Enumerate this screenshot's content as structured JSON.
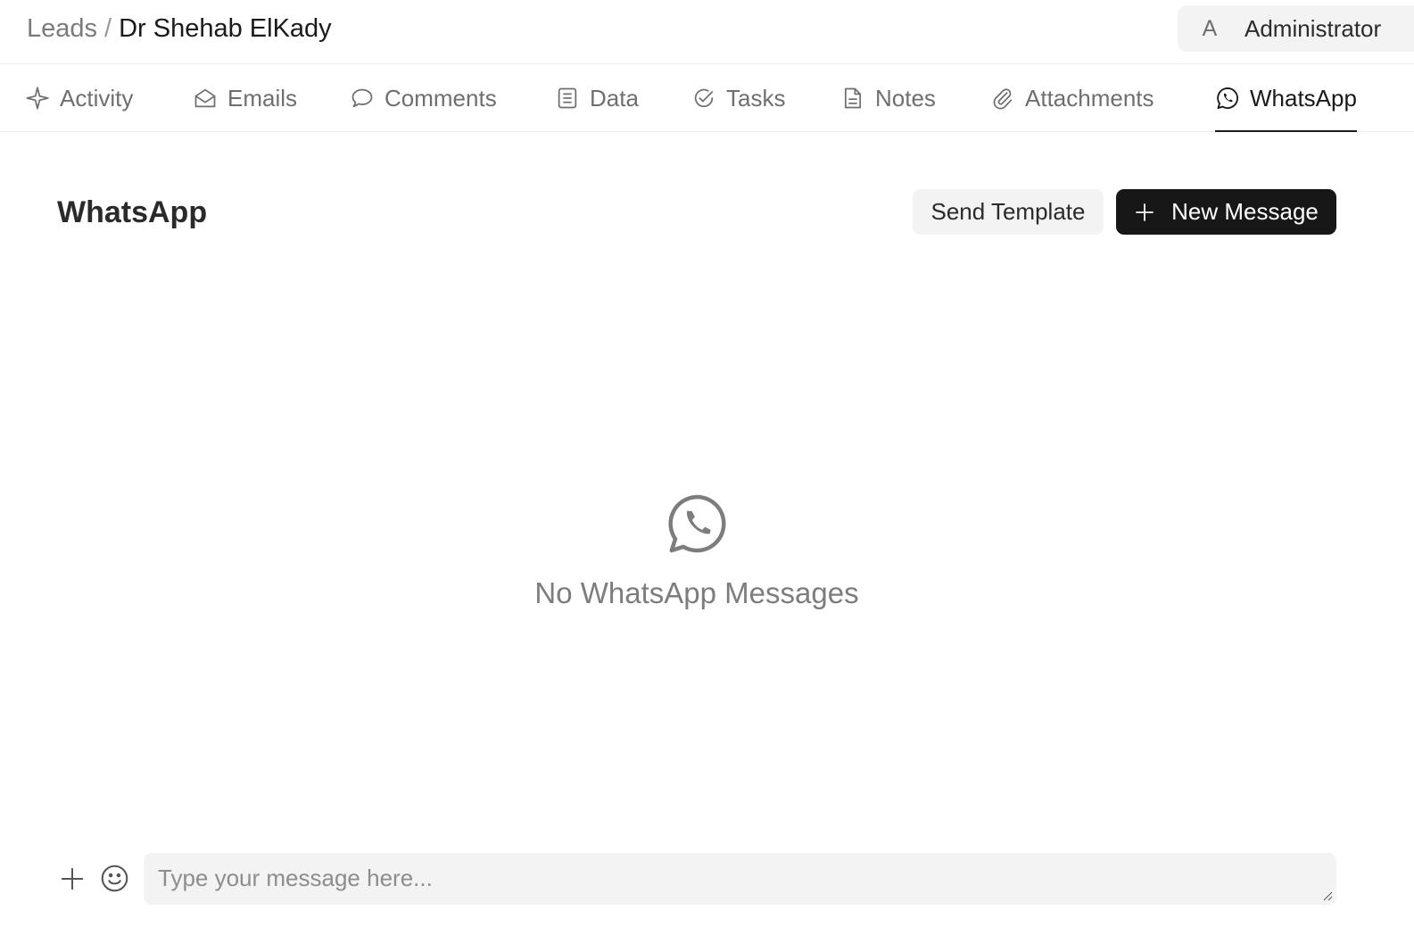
{
  "breadcrumb": {
    "parent": "Leads",
    "separator": "/",
    "current": "Dr Shehab ElKady"
  },
  "user": {
    "avatar_initial": "A",
    "name": "Administrator"
  },
  "tabs": [
    {
      "label": "Activity",
      "icon": "sparkle-icon",
      "active": false
    },
    {
      "label": "Emails",
      "icon": "mail-icon",
      "active": false
    },
    {
      "label": "Comments",
      "icon": "comment-icon",
      "active": false
    },
    {
      "label": "Data",
      "icon": "list-icon",
      "active": false
    },
    {
      "label": "Tasks",
      "icon": "check-circle-icon",
      "active": false
    },
    {
      "label": "Notes",
      "icon": "note-icon",
      "active": false
    },
    {
      "label": "Attachments",
      "icon": "paperclip-icon",
      "active": false
    },
    {
      "label": "WhatsApp",
      "icon": "whatsapp-icon",
      "active": true
    }
  ],
  "section": {
    "title": "WhatsApp",
    "send_template_label": "Send Template",
    "new_message_label": "New Message"
  },
  "empty_state": {
    "icon": "whatsapp-icon",
    "text": "No WhatsApp Messages"
  },
  "composer": {
    "placeholder": "Type your message here...",
    "value": ""
  },
  "colors": {
    "primary_button": "#171717",
    "secondary_button": "#f3f3f3",
    "muted_text": "#7d7d7d",
    "active_tab_underline": "#1a1a1a"
  }
}
